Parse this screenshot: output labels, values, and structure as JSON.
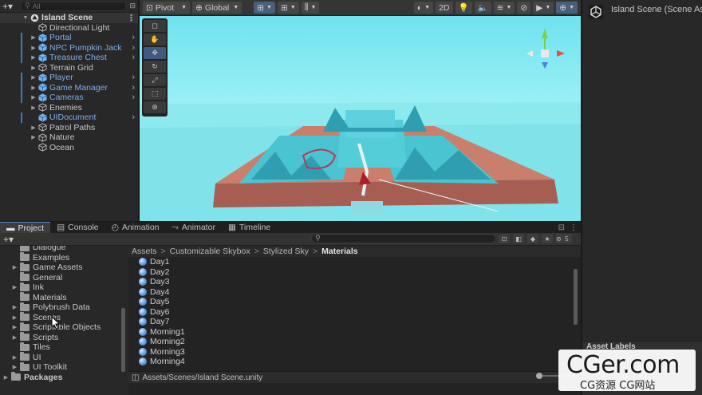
{
  "hierarchy": {
    "search_placeholder": "All",
    "scene_name": "Island Scene",
    "items": [
      {
        "label": "Directional Light",
        "prefab": false,
        "arrow": false
      },
      {
        "label": "Portal",
        "prefab": true,
        "arrow": true
      },
      {
        "label": "NPC Pumpkin Jack",
        "prefab": true,
        "arrow": true
      },
      {
        "label": "Treasure Chest",
        "prefab": true,
        "arrow": true
      },
      {
        "label": "Terrain Grid",
        "prefab": false,
        "arrow": true
      },
      {
        "label": "Player",
        "prefab": true,
        "arrow": true
      },
      {
        "label": "Game Manager",
        "prefab": true,
        "arrow": true
      },
      {
        "label": "Cameras",
        "prefab": true,
        "arrow": true
      },
      {
        "label": "Enemies",
        "prefab": false,
        "arrow": true
      },
      {
        "label": "UIDocument",
        "prefab": true,
        "arrow": false
      },
      {
        "label": "Patrol Paths",
        "prefab": false,
        "arrow": true
      },
      {
        "label": "Nature",
        "prefab": false,
        "arrow": true
      },
      {
        "label": "Ocean",
        "prefab": false,
        "arrow": false
      }
    ]
  },
  "scene_toolbar": {
    "pivot": "Pivot",
    "global": "Global",
    "mode_2d": "2D"
  },
  "inspector": {
    "title": "Island Scene (Scene As",
    "asset_labels": "Asset Labels"
  },
  "bottom_tabs": [
    {
      "label": "Project",
      "active": true
    },
    {
      "label": "Console",
      "active": false
    },
    {
      "label": "Animation",
      "active": false
    },
    {
      "label": "Animator",
      "active": false
    },
    {
      "label": "Timeline",
      "active": false
    }
  ],
  "hidden_count": "5",
  "folders": [
    {
      "label": "Dialogue",
      "arrow": false
    },
    {
      "label": "Examples",
      "arrow": false
    },
    {
      "label": "Game Assets",
      "arrow": true
    },
    {
      "label": "General",
      "arrow": false
    },
    {
      "label": "Ink",
      "arrow": true
    },
    {
      "label": "Materials",
      "arrow": false
    },
    {
      "label": "Polybrush Data",
      "arrow": true
    },
    {
      "label": "Scenes",
      "arrow": true
    },
    {
      "label": "Scriptable Objects",
      "arrow": true
    },
    {
      "label": "Scripts",
      "arrow": true
    },
    {
      "label": "Tiles",
      "arrow": false
    },
    {
      "label": "UI",
      "arrow": true
    },
    {
      "label": "UI Toolkit",
      "arrow": true
    }
  ],
  "packages_label": "Packages",
  "breadcrumb": [
    "Assets",
    "Customizable Skybox",
    "Stylized Sky",
    "Materials"
  ],
  "assets": [
    "Day1",
    "Day2",
    "Day3",
    "Day4",
    "Day5",
    "Day6",
    "Day7",
    "Morning1",
    "Morning2",
    "Morning3",
    "Morning4"
  ],
  "status_path": "Assets/Scenes/Island Scene.unity",
  "watermark": {
    "main": "CGer.com",
    "sub": "CG资源 CG网站"
  }
}
